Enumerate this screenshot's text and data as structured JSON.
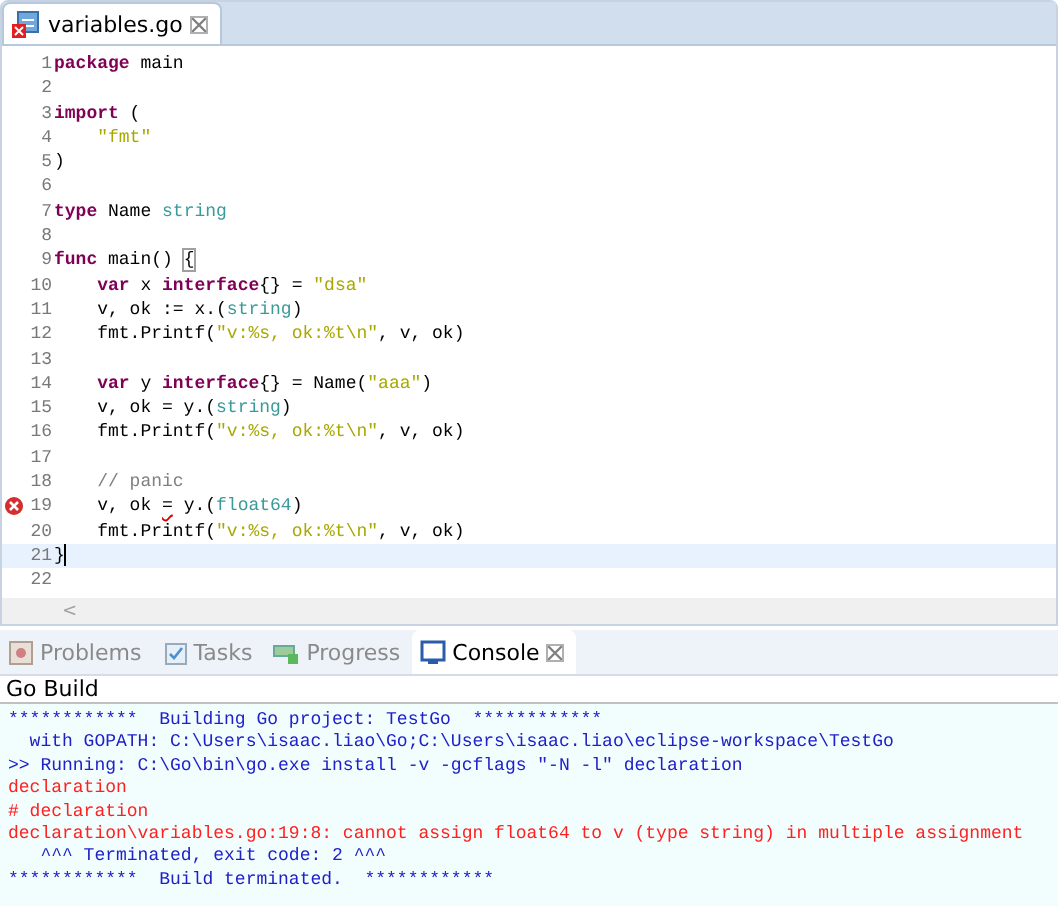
{
  "editor": {
    "tab": {
      "label": "variables.go",
      "selected": true,
      "has_error": true
    },
    "lines": [
      {
        "number": "1",
        "current": false,
        "error": false,
        "tokens": [
          {
            "kind": "keyword",
            "text": "package"
          },
          {
            "kind": "plain",
            "text": " main"
          }
        ]
      },
      {
        "number": "2",
        "current": false,
        "error": false
      },
      {
        "number": "3",
        "current": false,
        "error": false,
        "tokens": [
          {
            "kind": "keyword",
            "text": "import"
          },
          {
            "kind": "plain",
            "text": " ("
          }
        ]
      },
      {
        "number": "4",
        "current": false,
        "error": false,
        "tokens": [
          {
            "kind": "string",
            "text": "    \"fmt\""
          }
        ]
      },
      {
        "number": "5",
        "current": false,
        "error": false,
        "tokens": [
          {
            "kind": "plain",
            "text": ")"
          }
        ]
      },
      {
        "number": "6",
        "current": false,
        "error": false
      },
      {
        "number": "7",
        "current": false,
        "error": false,
        "tokens": [
          {
            "kind": "keyword",
            "text": "type"
          },
          {
            "kind": "plain",
            "text": " Name "
          },
          {
            "kind": "type",
            "text": "string"
          }
        ]
      },
      {
        "number": "8",
        "current": false,
        "error": false
      },
      {
        "number": "9",
        "current": false,
        "error": false,
        "tokens": [
          {
            "kind": "keyword",
            "text": "func"
          },
          {
            "kind": "plain",
            "text": " main() "
          },
          {
            "kind": "bracket",
            "text": "{"
          }
        ]
      },
      {
        "number": "10",
        "current": false,
        "error": false,
        "tokens": [
          {
            "kind": "keyword",
            "text": "    var"
          },
          {
            "kind": "plain",
            "text": " x "
          },
          {
            "kind": "keyword",
            "text": "interface"
          },
          {
            "kind": "plain",
            "text": "{} = "
          },
          {
            "kind": "string",
            "text": "\"dsa\""
          }
        ]
      },
      {
        "number": "11",
        "current": false,
        "error": false,
        "tokens": [
          {
            "kind": "plain",
            "text": "    v, ok := x.("
          },
          {
            "kind": "type",
            "text": "string"
          },
          {
            "kind": "plain",
            "text": ")"
          }
        ]
      },
      {
        "number": "12",
        "current": false,
        "error": false,
        "tokens": [
          {
            "kind": "plain",
            "text": "    fmt.Printf("
          },
          {
            "kind": "string",
            "text": "\"v:%s, ok:%t\\n\""
          },
          {
            "kind": "plain",
            "text": ", v, ok)"
          }
        ]
      },
      {
        "number": "13",
        "current": false,
        "error": false
      },
      {
        "number": "14",
        "current": false,
        "error": false,
        "tokens": [
          {
            "kind": "keyword",
            "text": "    var"
          },
          {
            "kind": "plain",
            "text": " y "
          },
          {
            "kind": "keyword",
            "text": "interface"
          },
          {
            "kind": "plain",
            "text": "{} = Name("
          },
          {
            "kind": "string",
            "text": "\"aaa\""
          },
          {
            "kind": "plain",
            "text": ")"
          }
        ]
      },
      {
        "number": "15",
        "current": false,
        "error": false,
        "tokens": [
          {
            "kind": "plain",
            "text": "    v, ok = y.("
          },
          {
            "kind": "type",
            "text": "string"
          },
          {
            "kind": "plain",
            "text": ")"
          }
        ]
      },
      {
        "number": "16",
        "current": false,
        "error": false,
        "tokens": [
          {
            "kind": "plain",
            "text": "    fmt.Printf("
          },
          {
            "kind": "string",
            "text": "\"v:%s, ok:%t\\n\""
          },
          {
            "kind": "plain",
            "text": ", v, ok)"
          }
        ]
      },
      {
        "number": "17",
        "current": false,
        "error": false
      },
      {
        "number": "18",
        "current": false,
        "error": false,
        "tokens": [
          {
            "kind": "comment",
            "text": "    // panic"
          }
        ]
      },
      {
        "number": "19",
        "current": false,
        "error": true,
        "tokens": [
          {
            "kind": "plain",
            "text": "    v, ok "
          },
          {
            "kind": "error",
            "text": "="
          },
          {
            "kind": "plain",
            "text": " y.("
          },
          {
            "kind": "type",
            "text": "float64"
          },
          {
            "kind": "plain",
            "text": ")"
          }
        ]
      },
      {
        "number": "20",
        "current": false,
        "error": false,
        "tokens": [
          {
            "kind": "plain",
            "text": "    fmt.Printf("
          },
          {
            "kind": "string",
            "text": "\"v:%s, ok:%t\\n\""
          },
          {
            "kind": "plain",
            "text": ", v, ok)"
          }
        ]
      },
      {
        "number": "21",
        "current": true,
        "error": false,
        "tokens": [
          {
            "kind": "plain",
            "text": "}"
          }
        ]
      },
      {
        "number": "22",
        "current": false,
        "error": false
      }
    ],
    "scroll_arrow": "<"
  },
  "panel": {
    "tabs": [
      {
        "label": "Problems",
        "kind": "problems",
        "selected": false
      },
      {
        "label": "Tasks",
        "kind": "tasks",
        "selected": false
      },
      {
        "label": "Progress",
        "kind": "progress",
        "selected": false
      },
      {
        "label": "Console",
        "kind": "console",
        "selected": true
      }
    ],
    "console_title": "Go Build",
    "console_lines": [
      {
        "kind": "info",
        "text": "************  Building Go project: TestGo  ************"
      },
      {
        "kind": "info",
        "text": "  with GOPATH: C:\\Users\\isaac.liao\\Go;C:\\Users\\isaac.liao\\eclipse-workspace\\TestGo"
      },
      {
        "kind": "info",
        "text": ">> Running: C:\\Go\\bin\\go.exe install -v -gcflags \"-N -l\" declaration"
      },
      {
        "kind": "error",
        "text": "declaration"
      },
      {
        "kind": "error",
        "text": "# declaration"
      },
      {
        "kind": "error",
        "text": "declaration\\variables.go:19:8: cannot assign float64 to v (type string) in multiple assignment"
      },
      {
        "kind": "info",
        "text": "   ^^^ Terminated, exit code: 2 ^^^"
      },
      {
        "kind": "info",
        "text": "************  Build terminated.  ************"
      }
    ]
  }
}
